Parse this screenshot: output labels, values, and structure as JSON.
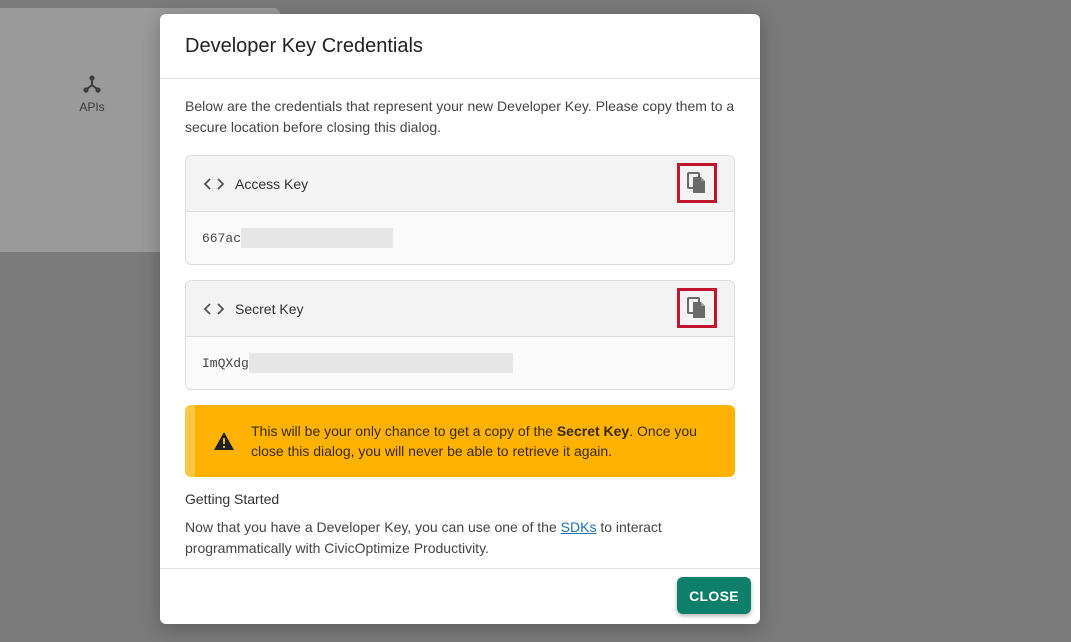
{
  "background": {
    "apis_label": "APIs"
  },
  "dialog": {
    "title": "Developer Key Credentials",
    "intro": "Below are the credentials that represent your new Developer Key. Please copy them to a secure location before closing this dialog.",
    "access_key": {
      "label": "Access Key",
      "value_prefix": "667ac"
    },
    "secret_key": {
      "label": "Secret Key",
      "value_prefix": "ImQXdg"
    },
    "warning": {
      "text_before": "This will be your only chance to get a copy of the ",
      "text_bold": "Secret Key",
      "text_after": ". Once you close this dialog, you will never be able to retrieve it again."
    },
    "getting_started": {
      "title": "Getting Started",
      "text_before": "Now that you have a Developer Key, you can use one of the ",
      "link": "SDKs",
      "text_after": " to interact programmatically with CivicOptimize Productivity."
    },
    "close_label": "CLOSE"
  },
  "colors": {
    "accent": "#0d7f6b",
    "warning": "#ffb300",
    "highlight_border": "#c0152f",
    "link": "#1f6fb2"
  },
  "icons": [
    "apis-icon",
    "code-icon",
    "copy-icon",
    "warning-icon"
  ]
}
